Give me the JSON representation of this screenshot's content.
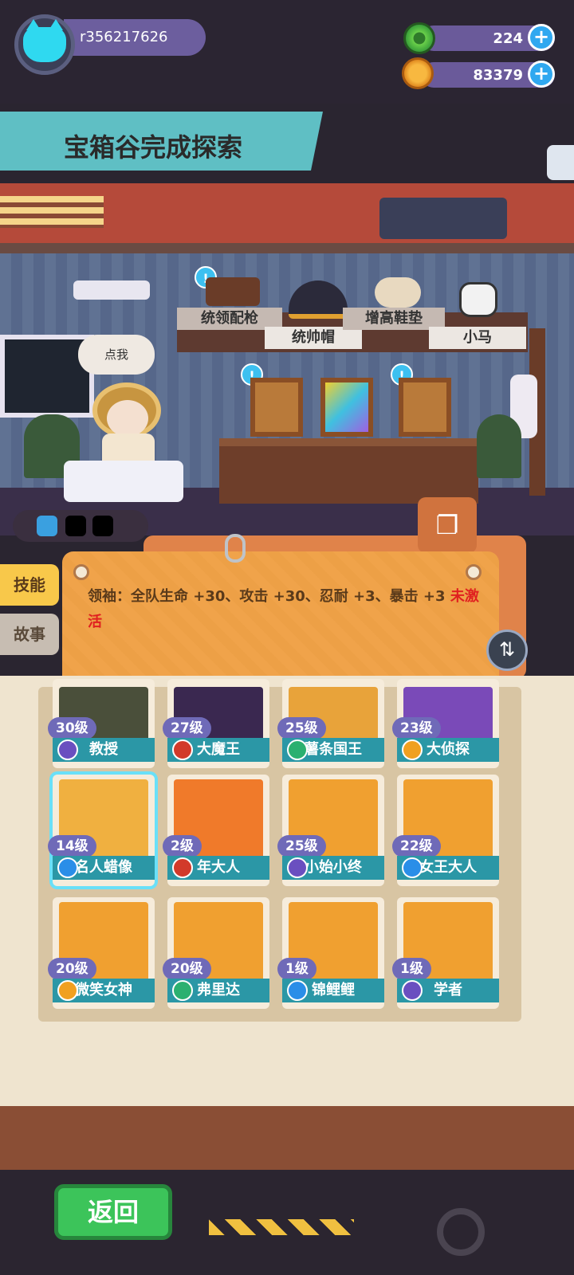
{
  "header": {
    "username": "r356217626",
    "currency": [
      {
        "icon": "green-gem-icon",
        "value": "224"
      },
      {
        "icon": "gold-planet-coin-icon",
        "value": "83379"
      }
    ]
  },
  "banner": {
    "text": "宝箱谷完成探索"
  },
  "room": {
    "speech_bubble": "点我",
    "equipment": [
      {
        "label": "统领配枪",
        "icon": "pistol-icon"
      },
      {
        "label": "统帅帽",
        "icon": "bicorne-hat-icon"
      },
      {
        "label": "增高鞋垫",
        "icon": "insole-icon"
      },
      {
        "label": "小马",
        "icon": "pony-icon"
      }
    ]
  },
  "skill_panel": {
    "tabs": [
      "技能",
      "故事"
    ],
    "text": "领袖：全队生命 +30、攻击 +30、忍耐 +3、暴击 +3",
    "status": "未激活"
  },
  "characters": [
    {
      "level": "30级",
      "name": "教授",
      "badge_color": "#6a4fc0",
      "art_color": "#4a4f3a"
    },
    {
      "level": "27级",
      "name": "大魔王",
      "badge_color": "#d23a2a",
      "art_color": "#3a2850"
    },
    {
      "level": "25级",
      "name": "薯条国王",
      "badge_color": "#2bb070",
      "art_color": "#e8a33a"
    },
    {
      "level": "23级",
      "name": "大侦探",
      "badge_color": "#f0a020",
      "art_color": "#7a4ab8"
    },
    {
      "level": "14级",
      "name": "名人蜡像",
      "badge_color": "#2a8ee8",
      "art_color": "#f0b040"
    },
    {
      "level": "2级",
      "name": "年大人",
      "badge_color": "#d23a2a",
      "art_color": "#f07a2a"
    },
    {
      "level": "25级",
      "name": "小始小终",
      "badge_color": "#6a4fc0",
      "art_color": "#f0a030"
    },
    {
      "level": "22级",
      "name": "女王大人",
      "badge_color": "#2a8ee8",
      "art_color": "#f0a030"
    },
    {
      "level": "20级",
      "name": "微笑女神",
      "badge_color": "#f0a020",
      "art_color": "#f0a030"
    },
    {
      "level": "20级",
      "name": "弗里达",
      "badge_color": "#2bb070",
      "art_color": "#f0a030"
    },
    {
      "level": "1级",
      "name": "锦鲤鲤",
      "badge_color": "#2a8ee8",
      "art_color": "#f0a030"
    },
    {
      "level": "1级",
      "name": "学者",
      "badge_color": "#6a4fc0",
      "art_color": "#f0a030"
    }
  ],
  "footer": {
    "back_label": "返回"
  }
}
